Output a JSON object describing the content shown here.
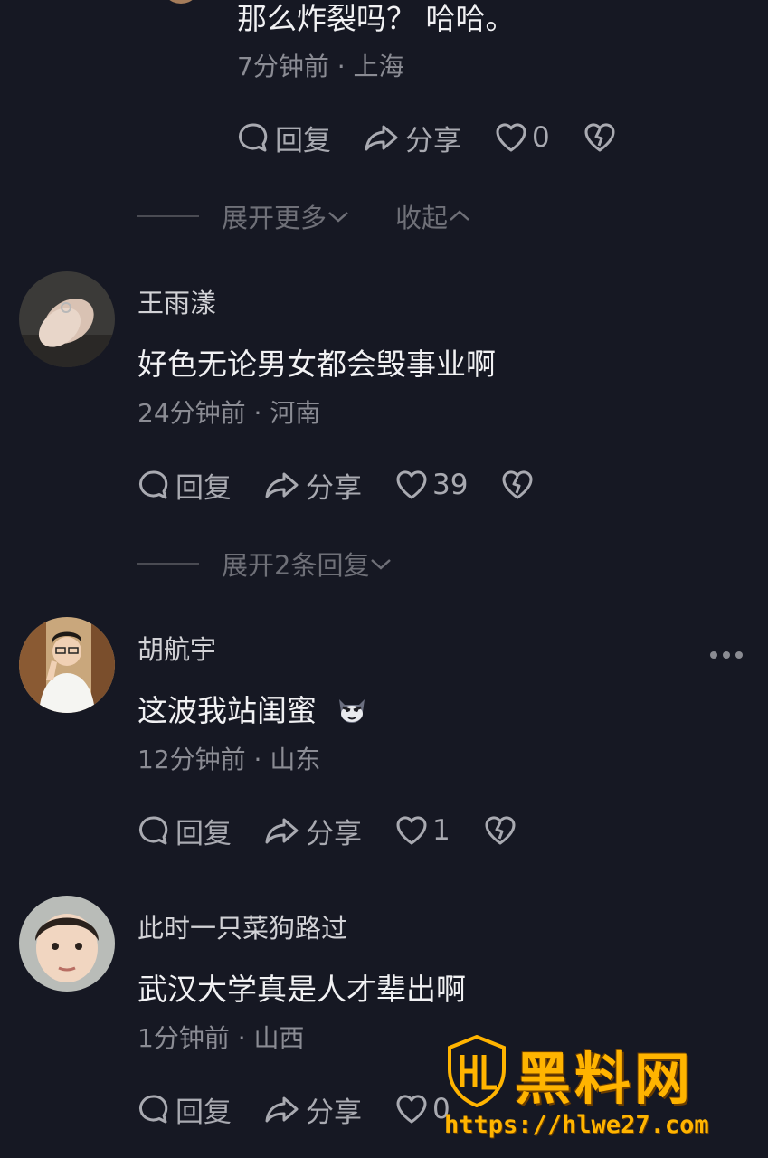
{
  "top_comment": {
    "text": "那么炸裂吗？ 哈哈。",
    "meta": "7分钟前 · 上海",
    "reply_label": "回复",
    "share_label": "分享",
    "like_count": "0"
  },
  "thread_controls": {
    "expand_more_label": "展开更多",
    "collapse_label": "收起"
  },
  "comments": [
    {
      "name": "王雨漾",
      "text": "好色无论男女都会毁事业啊",
      "meta": "24分钟前 · 河南",
      "reply_label": "回复",
      "share_label": "分享",
      "like_count": "39",
      "expand_replies_label": "展开2条回复"
    },
    {
      "name": "胡航宇",
      "text": "这波我站闺蜜",
      "emoji": "cat-face-emoji",
      "meta": "12分钟前 · 山东",
      "reply_label": "回复",
      "share_label": "分享",
      "like_count": "1"
    },
    {
      "name": "此时一只菜狗路过",
      "text": "武汉大学真是人才辈出啊",
      "meta": "1分钟前 · 山西",
      "reply_label": "回复",
      "share_label": "分享",
      "like_count": "0"
    }
  ],
  "watermark": {
    "logo_text": "HL",
    "title": "黑料网",
    "url": "https://hlwe27.com"
  },
  "colors": {
    "background": "#161823",
    "accent": "#ffb400"
  }
}
